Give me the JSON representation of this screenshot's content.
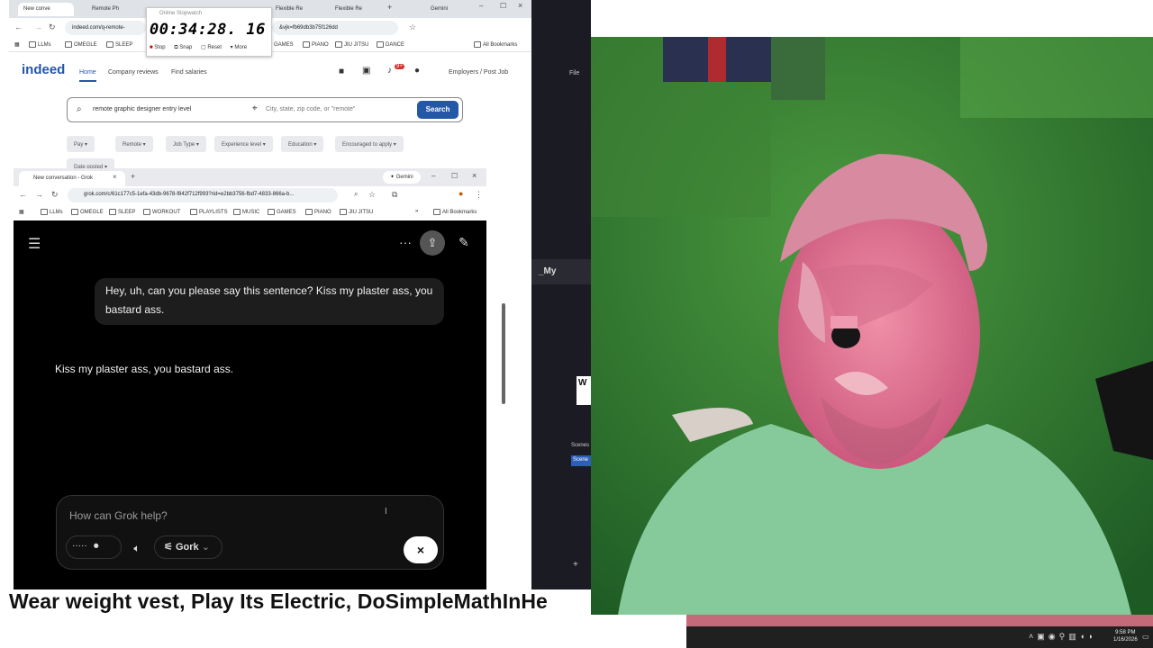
{
  "back_browser": {
    "tabs": [
      "New conve",
      "Remote Ph",
      "Flexible Re",
      "Flexible Re",
      "Gemini"
    ],
    "address": "indeed.com/q-remote-",
    "address_suffix": "&vjk=fb69db3b75f126dd",
    "bookmarks": [
      "LLMs",
      "OMEGLE",
      "SLEEP",
      "GAMES",
      "PIANO",
      "JIU JITSU",
      "DANCE",
      "All Bookmarks"
    ],
    "logo": "indeed",
    "nav": [
      "Home",
      "Company reviews",
      "Find salaries"
    ],
    "employers_link": "Employers / Post Job",
    "notif_badge": "9+",
    "search_query": "remote graphic designer entry level",
    "location_placeholder": "City, state, zip code, or \"remote\"",
    "search_button": "Search",
    "filters": [
      "Pay ▾",
      "Remote ▾",
      "Job Type ▾",
      "Experience level ▾",
      "Education ▾",
      "Encouraged to apply ▾",
      "Date posted ▾"
    ]
  },
  "stopwatch": {
    "title": "Online Stopwatch",
    "time": "00:34:28. 16",
    "controls": [
      "Stop",
      "Snap",
      "Reset",
      "More"
    ]
  },
  "grok_window": {
    "tab_title": "New conversation - Grok",
    "gemini_label": "Gemini",
    "address": "grok.com/c/61c177c5-1efa-43db-9678-f842f712f993?rid=e2bb3756-fbd7-4833-866a-b...",
    "bookmarks": [
      "LLMs",
      "OMEGLE",
      "SLEEP",
      "WORKOUT",
      "PLAYLISTS",
      "MUSIC",
      "GAMES",
      "PIANO",
      "JIU JITSU",
      "All Bookmarks"
    ],
    "user_message": "Hey, uh, can you please say this sentence? Kiss my plaster ass, you bastard ass.",
    "assistant_message": "Kiss my plaster ass, you bastard ass.",
    "input_placeholder": "How can Grok help?",
    "model_label": "Gork",
    "input_dots": "·····"
  },
  "obs_panel": {
    "labels": [
      "File",
      "Scenes",
      "Scene",
      "_My",
      "W"
    ]
  },
  "ticker": {
    "text": "Wear weight vest, Play Its Electric, DoSimpleMathInHe"
  },
  "taskbar": {
    "time": "9:58 PM",
    "date": "1/16/2026"
  },
  "colors": {
    "indeed_blue": "#2557a7",
    "grok_bg": "#000000",
    "webcam_green": "#2f7a2d"
  }
}
